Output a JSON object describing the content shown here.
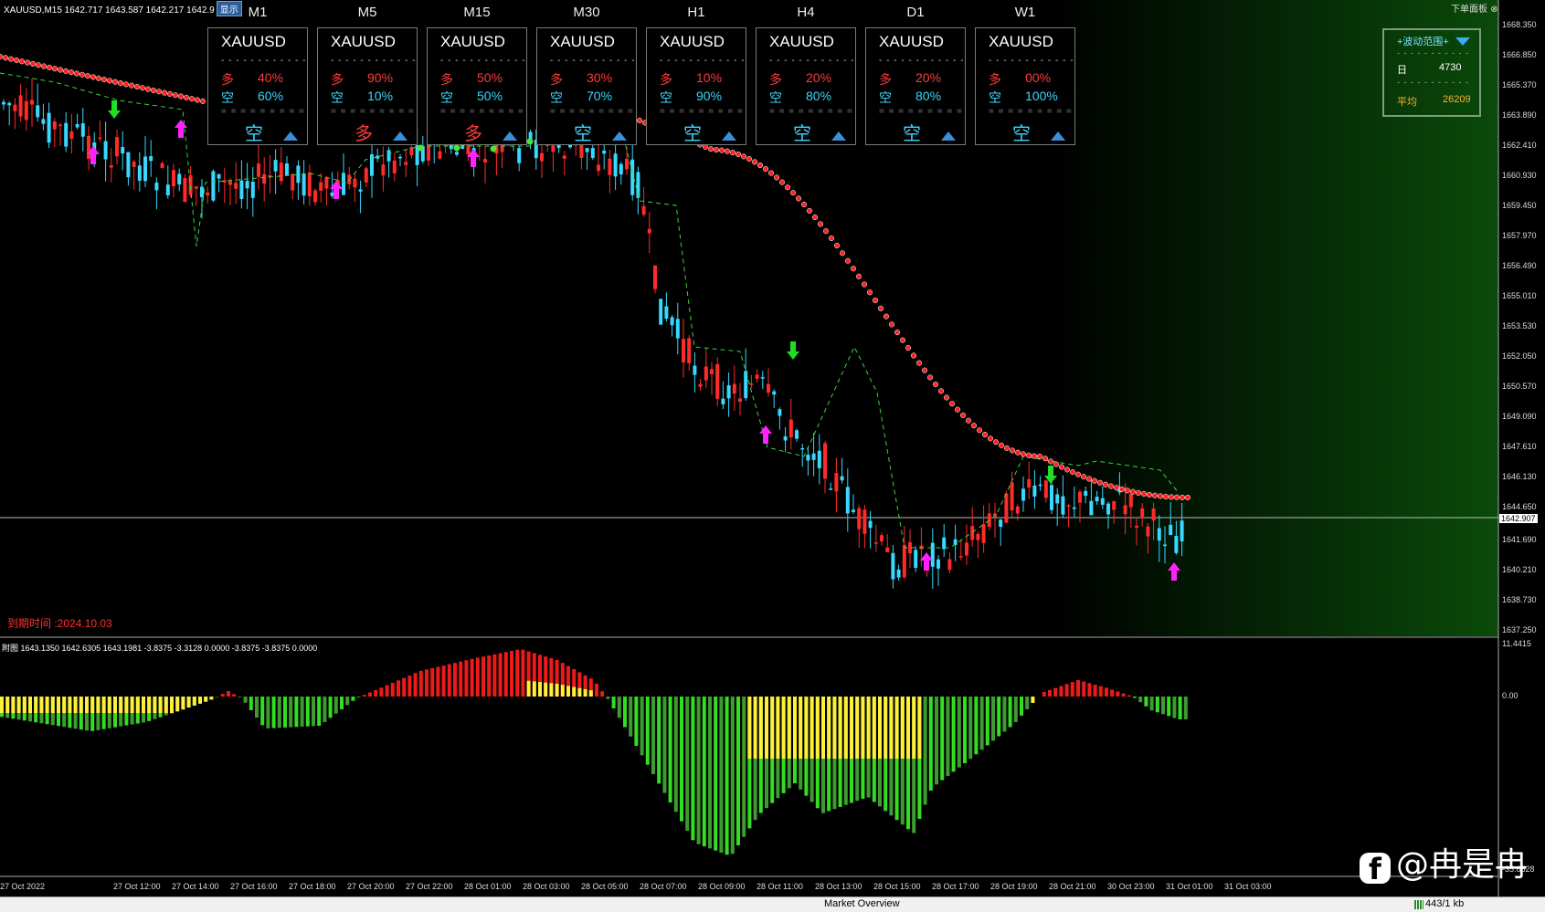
{
  "header": {
    "info": "XAUUSD,M15  1642.717 1643.587 1642.217 1642.9",
    "show_button": "显示",
    "close_menu": "下单面板"
  },
  "panels": [
    {
      "tf": "M1",
      "symbol": "XAUUSD",
      "long_label": "多",
      "long_pct": "40%",
      "short_label": "空",
      "short_pct": "60%",
      "signal": "空",
      "signal_color": "#38d8ff"
    },
    {
      "tf": "M5",
      "symbol": "XAUUSD",
      "long_label": "多",
      "long_pct": "90%",
      "short_label": "空",
      "short_pct": "10%",
      "signal": "多",
      "signal_color": "#ff3b3b"
    },
    {
      "tf": "M15",
      "symbol": "XAUUSD",
      "long_label": "多",
      "long_pct": "50%",
      "short_label": "空",
      "short_pct": "50%",
      "signal": "多",
      "signal_color": "#ff3b3b"
    },
    {
      "tf": "M30",
      "symbol": "XAUUSD",
      "long_label": "多",
      "long_pct": "30%",
      "short_label": "空",
      "short_pct": "70%",
      "signal": "空",
      "signal_color": "#38d8ff"
    },
    {
      "tf": "H1",
      "symbol": "XAUUSD",
      "long_label": "多",
      "long_pct": "10%",
      "short_label": "空",
      "short_pct": "90%",
      "signal": "空",
      "signal_color": "#38d8ff"
    },
    {
      "tf": "H4",
      "symbol": "XAUUSD",
      "long_label": "多",
      "long_pct": "20%",
      "short_label": "空",
      "short_pct": "80%",
      "signal": "空",
      "signal_color": "#38d8ff"
    },
    {
      "tf": "D1",
      "symbol": "XAUUSD",
      "long_label": "多",
      "long_pct": "20%",
      "short_label": "空",
      "short_pct": "80%",
      "signal": "空",
      "signal_color": "#38d8ff"
    },
    {
      "tf": "W1",
      "symbol": "XAUUSD",
      "long_label": "多",
      "long_pct": "00%",
      "short_label": "空",
      "short_pct": "100%",
      "signal": "空",
      "signal_color": "#38d8ff"
    }
  ],
  "range_box": {
    "title": "+波动范围+",
    "day_label": "日",
    "day_value": "4730",
    "avg_label": "平均",
    "avg_value": "26209"
  },
  "expiry": "到期时间 :2024.10.03",
  "sub_window": {
    "info": "附图 1643.1350 1642.6305 1643.1981 -3.8375 -3.3128 0.0000 -3.8375 -3.8375 0.0000",
    "labels": [
      "11.4415",
      "0.00",
      "-35.6528"
    ]
  },
  "price_axis": [
    "1668.350",
    "1666.850",
    "1665.370",
    "1663.890",
    "1662.410",
    "1660.930",
    "1659.450",
    "1657.970",
    "1656.490",
    "1655.010",
    "1653.530",
    "1652.050",
    "1650.570",
    "1649.090",
    "1647.610",
    "1646.130",
    "1644.650",
    "1641.690",
    "1640.210",
    "1638.730",
    "1637.250"
  ],
  "current_price": "1642.907",
  "time_axis": [
    "27 Oct 2022",
    "27 Oct 12:00",
    "27 Oct 14:00",
    "27 Oct 16:00",
    "27 Oct 18:00",
    "27 Oct 20:00",
    "27 Oct 22:00",
    "28 Oct 01:00",
    "28 Oct 03:00",
    "28 Oct 05:00",
    "28 Oct 07:00",
    "28 Oct 09:00",
    "28 Oct 11:00",
    "28 Oct 13:00",
    "28 Oct 15:00",
    "28 Oct 17:00",
    "28 Oct 19:00",
    "28 Oct 21:00",
    "30 Oct 23:00",
    "31 Oct 01:00",
    "31 Oct 03:00"
  ],
  "watermark": "@冉是冉",
  "statusbar": {
    "market_overview": "Market Overview",
    "traffic": "443/1 kb"
  },
  "colors": {
    "bull": "#ff2a2a",
    "bear": "#38d8ff",
    "ma_line": "#ff2020",
    "hist_green": "#33dd22",
    "hist_darkgreen": "#3e9b32",
    "hist_yellow": "#ffef3a",
    "hist_red": "#ee1a1a"
  }
}
